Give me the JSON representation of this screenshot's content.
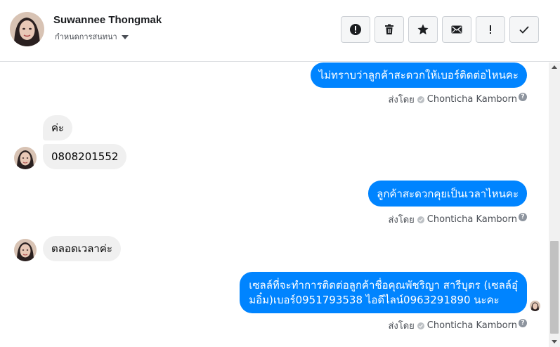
{
  "header": {
    "name": "Suwannee Thongmak",
    "subtitle": "กำหนดการสนทนา"
  },
  "toolbar": {
    "buttons": [
      {
        "icon": "alert-circle-icon"
      },
      {
        "icon": "trash-icon"
      },
      {
        "icon": "star-icon"
      },
      {
        "icon": "envelope-icon"
      },
      {
        "icon": "exclamation-icon",
        "label": "!"
      },
      {
        "icon": "checkmark-icon"
      }
    ]
  },
  "messages": {
    "out1": "ไม่ทราบว่าลูกค้าสะดวกให้เบอร์ติดต่อไหนคะ",
    "in1": "ค่ะ",
    "in2": "0808201552",
    "out2": "ลูกค้าสะดวกคุยเป็นเวลาไหนคะ",
    "in3": "ตลอดเวลาค่ะ",
    "out3_line1": "เซลล์ที่จะทำการติดต่อลูกค้าชื่อคุณพัชริญา สารีบุตร (เซลล์อุ๋",
    "out3_line2": "มอิ๋ม)เบอร์0951793538 ไอดีไลน์0963291890 นะคะ"
  },
  "sent_by": {
    "prefix": "ส่งโดย",
    "agent": "Chonticha Kamborn",
    "help": "?"
  },
  "colors": {
    "outgoing_bubble": "#0084ff",
    "incoming_bubble": "#f0f0f0"
  }
}
